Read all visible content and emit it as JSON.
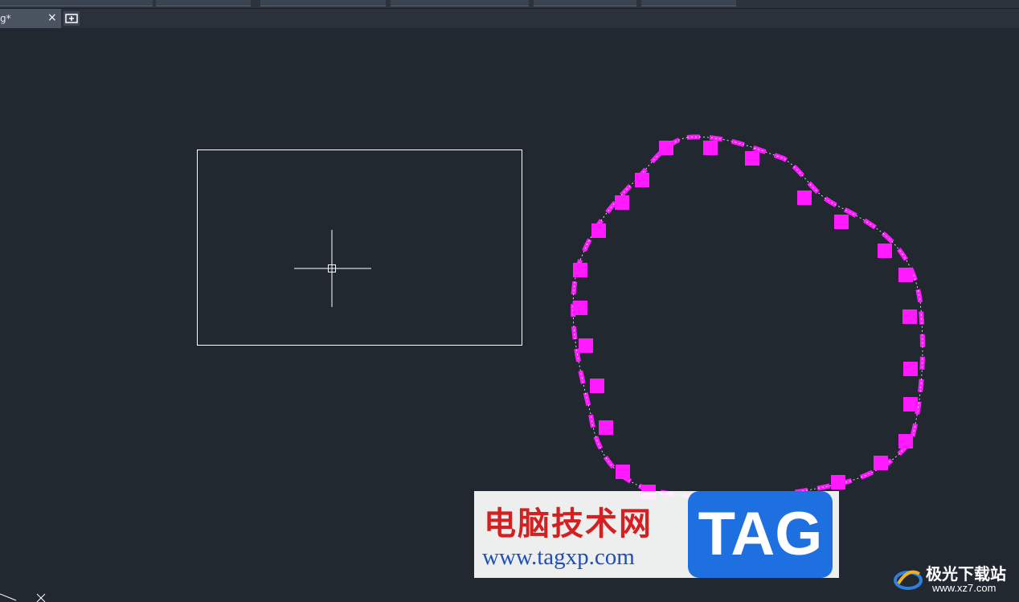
{
  "toolbar": {
    "label": "toolbar"
  },
  "document_tab": {
    "title": "g*",
    "close_icon": "×"
  },
  "canvas": {
    "background": "#212830",
    "rectangle_color": "#ffffff",
    "selection_grip_color": "#ff1aff",
    "crosshair_color": "#ffffff"
  },
  "watermark": {
    "title": "电脑技术网",
    "url": "www.tagxp.com",
    "tag": "TAG"
  },
  "corner_logo": {
    "name": "极光下载站",
    "site": "www.xz7.com"
  }
}
